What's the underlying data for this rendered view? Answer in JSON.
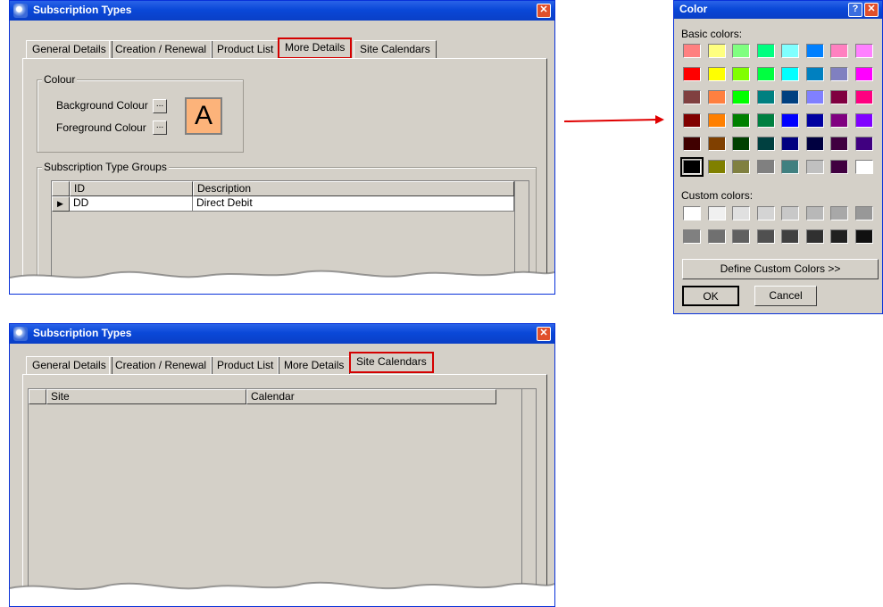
{
  "window1": {
    "title": "Subscription Types",
    "tabs": [
      "General Details",
      "Creation / Renewal",
      "Product List",
      "More Details",
      "Site Calendars"
    ],
    "active_tab": "More Details",
    "colour_group": {
      "legend": "Colour",
      "background_label": "Background Colour",
      "foreground_label": "Foreground Colour",
      "button_label": "...",
      "sample_text": "A",
      "sample_background": "#fcb37a"
    },
    "groups_group": {
      "legend": "Subscription Type Groups",
      "columns": [
        "ID",
        "Description"
      ],
      "rows": [
        {
          "id": "DD",
          "description": "Direct Debit"
        }
      ],
      "row_indicator": "▶"
    }
  },
  "window2": {
    "title": "Subscription Types",
    "tabs": [
      "General Details",
      "Creation / Renewal",
      "Product List",
      "More Details",
      "Site Calendars"
    ],
    "active_tab": "Site Calendars",
    "grid": {
      "columns": [
        "Site",
        "Calendar"
      ]
    }
  },
  "color_dialog": {
    "title": "Color",
    "help_label": "?",
    "close_label": "✕",
    "basic_label": "Basic colors:",
    "basic_colors": [
      [
        "#ff8080",
        "#ffff80",
        "#80ff80",
        "#00ff80",
        "#80ffff",
        "#0080ff",
        "#ff80c0",
        "#ff80ff"
      ],
      [
        "#ff0000",
        "#ffff00",
        "#80ff00",
        "#00ff40",
        "#00ffff",
        "#0080c0",
        "#8080c0",
        "#ff00ff"
      ],
      [
        "#804040",
        "#ff8040",
        "#00ff00",
        "#008080",
        "#004080",
        "#8080ff",
        "#800040",
        "#ff0080"
      ],
      [
        "#800000",
        "#ff8000",
        "#008000",
        "#008040",
        "#0000ff",
        "#0000a0",
        "#800080",
        "#8000ff"
      ],
      [
        "#400000",
        "#804000",
        "#004000",
        "#004040",
        "#000080",
        "#000040",
        "#400040",
        "#400080"
      ],
      [
        "#000000",
        "#808000",
        "#808040",
        "#808080",
        "#408080",
        "#c0c0c0",
        "#400040",
        "#ffffff"
      ]
    ],
    "selected_color": "#000000",
    "custom_label": "Custom colors:",
    "custom_colors": [
      [
        "#ffffff",
        "#f0f0f0",
        "#e0e0e0",
        "#d4d4d4",
        "#c8c8c8",
        "#b8b8b8",
        "#a8a8a8",
        "#989898"
      ],
      [
        "#808080",
        "#707070",
        "#606060",
        "#505050",
        "#404040",
        "#303030",
        "#202020",
        "#101010"
      ]
    ],
    "define_button": "Define Custom Colors >>",
    "ok_button": "OK",
    "cancel_button": "Cancel"
  },
  "colors": {
    "title_blue": "#0a48d8",
    "highlight_red": "#d40000",
    "face": "#d4d0c8",
    "arrow": "#e00000"
  }
}
